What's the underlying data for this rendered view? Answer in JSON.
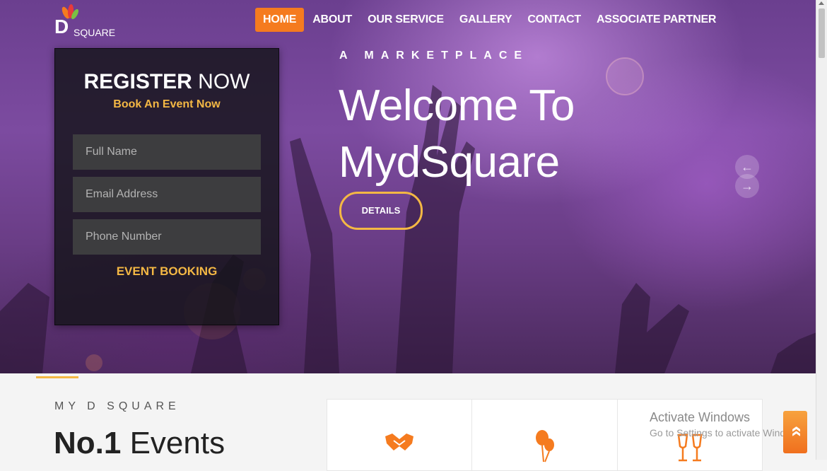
{
  "logo": {
    "letter": "D",
    "text": "SQUARE"
  },
  "nav": {
    "items": [
      {
        "label": "HOME",
        "active": true
      },
      {
        "label": "ABOUT"
      },
      {
        "label": "OUR SERVICE"
      },
      {
        "label": "GALLERY"
      },
      {
        "label": "CONTACT"
      },
      {
        "label": "ASSOCIATE PARTNER"
      }
    ]
  },
  "register": {
    "title_bold": "REGISTER",
    "title_rest": " NOW",
    "subtitle": "Book An Event Now",
    "fields": {
      "name_placeholder": "Full Name",
      "email_placeholder": "Email Address",
      "phone_placeholder": "Phone Number"
    },
    "submit_label": "EVENT BOOKING"
  },
  "hero": {
    "tagline": "A MARKETPLACE",
    "headline_line1": "Welcome To",
    "headline_line2": "MydSquare",
    "details_label": "DETAILS",
    "prev_icon": "arrow-left-icon",
    "next_icon": "arrow-right-icon"
  },
  "section": {
    "eyebrow": "MY D SQUARE",
    "title_bold": "No.1",
    "title_rest": " Events"
  },
  "cards": [
    {
      "icon": "handshake-icon"
    },
    {
      "icon": "balloons-icon"
    },
    {
      "icon": "champagne-glasses-icon"
    }
  ],
  "watermark": {
    "line1": "Activate Windows",
    "line2": "Go to Settings to activate Windows."
  },
  "back_to_top": {
    "icon": "double-chevron-up-icon",
    "glyph": "»"
  },
  "colors": {
    "accent": "#f57b1f",
    "gold": "#f4b844",
    "hero_purple": "#6b3f8f"
  }
}
